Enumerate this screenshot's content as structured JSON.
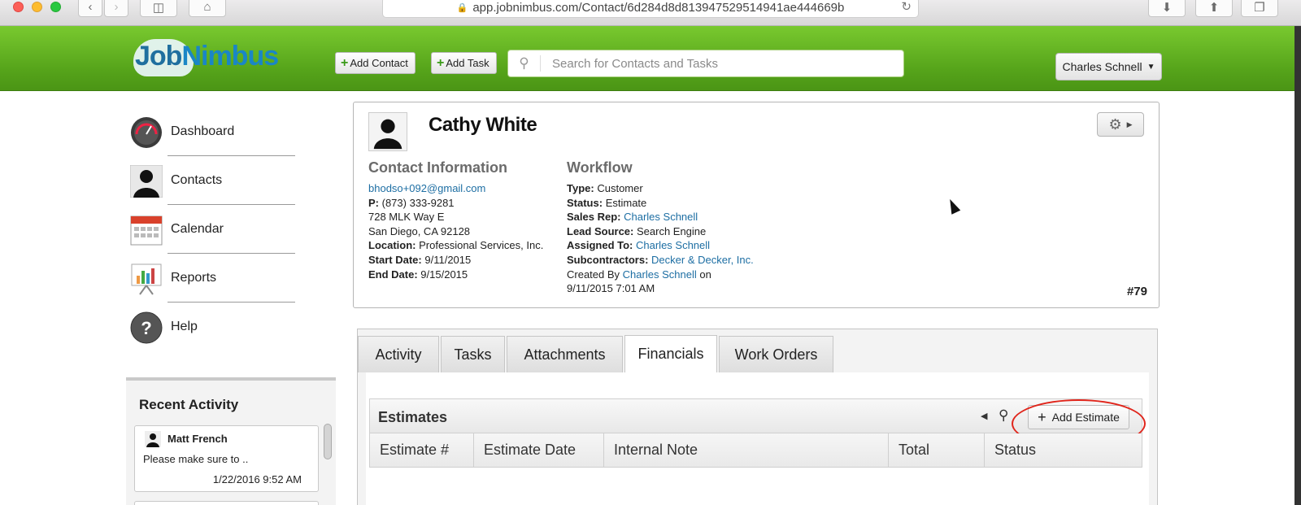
{
  "browser": {
    "url": "app.jobnimbus.com/Contact/6d284d8d813947529514941ae444669b",
    "nav_icons": [
      "back-icon",
      "forward-icon",
      "sidebar-icon",
      "home-icon"
    ],
    "action_icons": [
      "download-icon",
      "share-icon",
      "tabs-icon"
    ]
  },
  "header": {
    "logo_part1": "Job",
    "logo_part2": "Nimbus",
    "add_contact_label": "Add Contact",
    "add_task_label": "Add Task",
    "search_placeholder": "Search for Contacts and Tasks",
    "user_name": "Charles Schnell",
    "brand_green": "#5aaa1d"
  },
  "sidebar": {
    "items": [
      {
        "label": "Dashboard",
        "icon": "dashboard-gauge-icon"
      },
      {
        "label": "Contacts",
        "icon": "contacts-person-icon"
      },
      {
        "label": "Calendar",
        "icon": "calendar-icon"
      },
      {
        "label": "Reports",
        "icon": "reports-chart-icon"
      },
      {
        "label": "Help",
        "icon": "help-question-icon"
      }
    ],
    "recent_title": "Recent Activity",
    "recent": [
      {
        "name": "Matt French",
        "message": "Please make sure to ..",
        "time": "1/22/2016 9:52 AM"
      }
    ]
  },
  "contact": {
    "name": "Cathy White",
    "number": "#79",
    "info_title": "Contact Information",
    "email": "bhodso+092@gmail.com",
    "phone_label": "P:",
    "phone": "(873) 333-9281",
    "address1": "728 MLK Way E",
    "address2": "San Diego, CA 92128",
    "location_label": "Location:",
    "location": "Professional Services, Inc.",
    "start_label": "Start Date:",
    "start": "9/11/2015",
    "end_label": "End Date:",
    "end": "9/15/2015",
    "workflow_title": "Workflow",
    "type_label": "Type:",
    "type": "Customer",
    "status_label": "Status:",
    "status": "Estimate",
    "salesrep_label": "Sales Rep:",
    "salesrep": "Charles Schnell",
    "leadsource_label": "Lead Source:",
    "leadsource": "Search Engine",
    "assigned_label": "Assigned To:",
    "assigned": "Charles Schnell",
    "subs_label": "Subcontractors:",
    "subs": "Decker & Decker, Inc.",
    "created_prefix": "Created By",
    "created_by": "Charles Schnell",
    "created_suffix": "on",
    "created_at": "9/11/2015 7:01 AM"
  },
  "tabs": [
    {
      "label": "Activity"
    },
    {
      "label": "Tasks"
    },
    {
      "label": "Attachments"
    },
    {
      "label": "Financials",
      "active": true
    },
    {
      "label": "Work Orders"
    }
  ],
  "estimates": {
    "title": "Estimates",
    "add_label": "Add Estimate",
    "columns": [
      "Estimate #",
      "Estimate Date",
      "Internal Note",
      "Total",
      "Status"
    ]
  }
}
